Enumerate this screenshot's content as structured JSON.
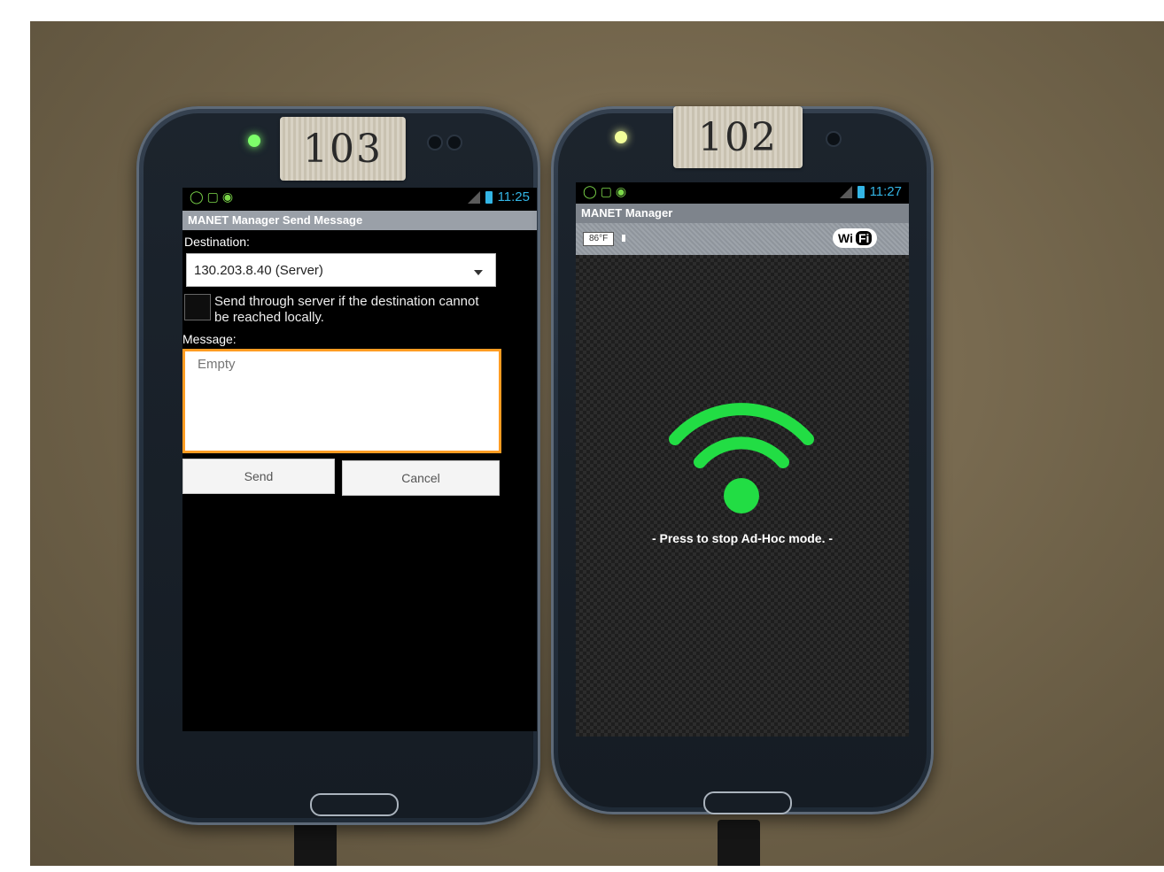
{
  "left_phone": {
    "tag_label": "103",
    "status": {
      "time": "11:25",
      "icons_left": "wifi, screen, android"
    },
    "titlebar": "MANET Manager Send Message",
    "destination_label": "Destination:",
    "destination_value": "130.203.8.40 (Server)",
    "checkbox_label_line1": "Send through server if the destination cannot",
    "checkbox_label_line2": "be reached locally.",
    "checkbox_checked": false,
    "message_label": "Message:",
    "message_placeholder": "Empty",
    "send_label": "Send",
    "cancel_label": "Cancel"
  },
  "right_phone": {
    "tag_label": "102",
    "status": {
      "time": "11:27"
    },
    "titlebar": "MANET Manager",
    "temperature": "86°F",
    "wifi_badge_wi": "Wi",
    "wifi_badge_fi": "Fi",
    "wifi_icon_color": "#22dd44",
    "press_text": "- Press to stop Ad-Hoc mode. -"
  },
  "colors": {
    "focus_border": "#ff9c22",
    "status_time": "#33b5e5",
    "led_left": "#7dff6a",
    "led_right": "#f3ff9a"
  }
}
